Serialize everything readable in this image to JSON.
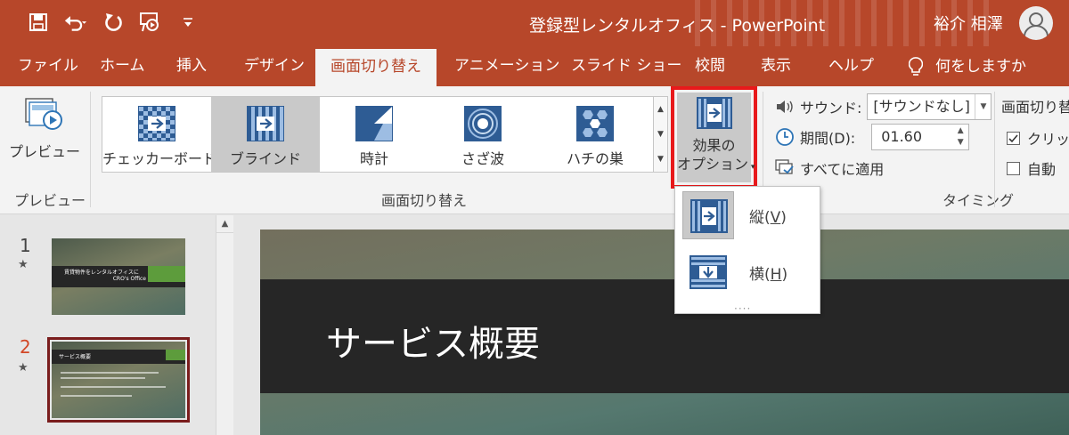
{
  "titlebar": {
    "title": "登録型レンタルオフィス  -  PowerPoint",
    "user": "裕介 相澤",
    "qat": [
      "save-icon",
      "undo-icon",
      "redo-icon",
      "start-from-beginning-icon",
      "customize-qat-icon"
    ]
  },
  "tabs": [
    {
      "label": "ファイル"
    },
    {
      "label": "ホーム"
    },
    {
      "label": "挿入"
    },
    {
      "label": "デザイン"
    },
    {
      "label": "画面切り替え"
    },
    {
      "label": "アニメーション"
    },
    {
      "label": "スライド ショー"
    },
    {
      "label": "校閲"
    },
    {
      "label": "表示"
    },
    {
      "label": "ヘルプ"
    }
  ],
  "tell_me": "何をしますか",
  "ribbon": {
    "preview": {
      "button": "プレビュー",
      "group": "プレビュー"
    },
    "transitions": {
      "group": "画面切り替え",
      "items": [
        {
          "label": "チェッカーボード",
          "icon": "checkerboard-transition-icon"
        },
        {
          "label": "ブラインド",
          "icon": "blinds-transition-icon",
          "selected": true
        },
        {
          "label": "時計",
          "icon": "clock-transition-icon"
        },
        {
          "label": "さざ波",
          "icon": "ripple-transition-icon"
        },
        {
          "label": "ハチの巣",
          "icon": "honeycomb-transition-icon"
        }
      ],
      "effect_options": {
        "line1": "効果の",
        "line2": "オプション"
      }
    },
    "timing": {
      "group": "タイミング",
      "sound_label": "サウンド:",
      "sound_value": "[サウンドなし]",
      "duration_label": "期間(D):",
      "duration_value": "01.60",
      "apply_all": "すべてに適用",
      "advance_title": "画面切り替",
      "on_click": "クリック",
      "auto": "自動"
    }
  },
  "effect_menu": {
    "items": [
      {
        "label": "縦",
        "key": "V",
        "selected": true
      },
      {
        "label": "横",
        "key": "H",
        "selected": false
      }
    ]
  },
  "slides": [
    {
      "number": "1",
      "title": "賃貸物件をレンタルオフィスに",
      "subtitle": "CRO's Office"
    },
    {
      "number": "2",
      "title": "サービス概要",
      "selected": true
    }
  ],
  "main_slide": {
    "title": "サービス概要"
  },
  "colors": {
    "accent": "#b7472a",
    "highlight": "#e8191b",
    "selected_slide_num": "#d24726"
  }
}
